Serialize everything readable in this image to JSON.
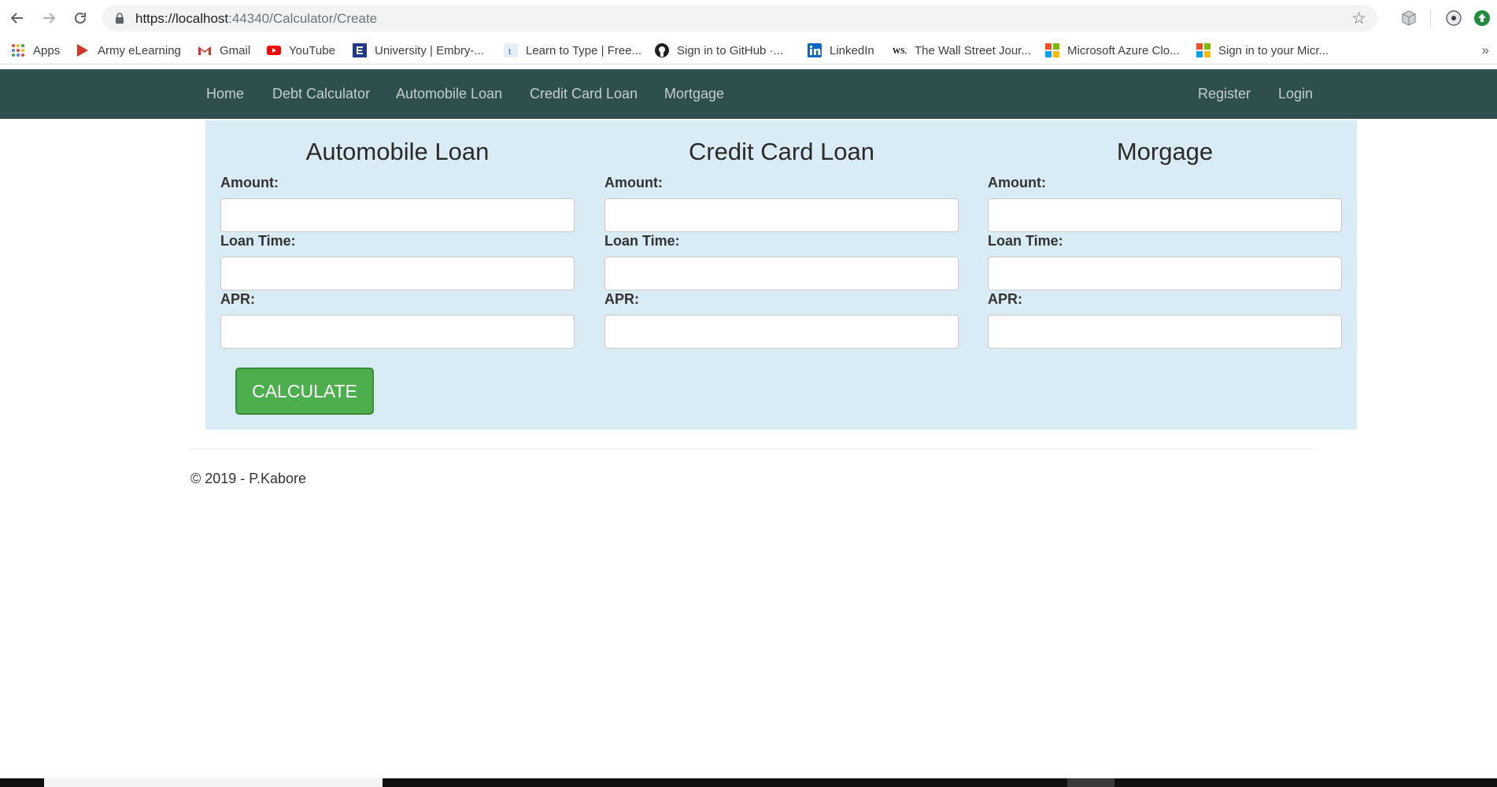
{
  "browser": {
    "url_prefix": "https://localhost",
    "url_suffix": ":44340/Calculator/Create",
    "icons": {
      "back": "arrow-left-icon",
      "forward": "arrow-right-icon",
      "reload": "reload-icon",
      "secure": "lock-icon",
      "bookmark": "star-icon"
    }
  },
  "bookmarks": [
    {
      "label": "Apps",
      "icon": "apps-grid-icon"
    },
    {
      "label": "Army eLearning",
      "icon": "army-icon"
    },
    {
      "label": "Gmail",
      "icon": "gmail-icon"
    },
    {
      "label": "YouTube",
      "icon": "youtube-icon"
    },
    {
      "label": "University | Embry-...",
      "icon": "university-icon"
    },
    {
      "label": "Learn to Type | Free...",
      "icon": "typing-icon"
    },
    {
      "label": "Sign in to GitHub ·...",
      "icon": "github-icon"
    },
    {
      "label": "LinkedIn",
      "icon": "linkedin-icon"
    },
    {
      "label": "The Wall Street Jour...",
      "icon": "wsj-icon"
    },
    {
      "label": "Microsoft Azure Clo...",
      "icon": "microsoft-icon"
    },
    {
      "label": "Sign in to your Micr...",
      "icon": "microsoft-icon"
    }
  ],
  "bookmarks_more": "»",
  "nav": {
    "home": "Home",
    "debt_calculator": "Debt Calculator",
    "automobile_loan": "Automobile Loan",
    "credit_card_loan": "Credit Card Loan",
    "mortgage": "Mortgage",
    "register": "Register",
    "login": "Login"
  },
  "calculator": {
    "columns": [
      {
        "title": "Automobile Loan",
        "amount_label": "Amount:",
        "amount_value": "",
        "time_label": "Loan Time:",
        "time_value": "",
        "apr_label": "APR:",
        "apr_value": ""
      },
      {
        "title": "Credit Card Loan",
        "amount_label": "Amount:",
        "amount_value": "",
        "time_label": "Loan Time:",
        "time_value": "",
        "apr_label": "APR:",
        "apr_value": ""
      },
      {
        "title": "Morgage",
        "amount_label": "Amount:",
        "amount_value": "",
        "time_label": "Loan Time:",
        "time_value": "",
        "apr_label": "APR:",
        "apr_value": ""
      }
    ],
    "button_label": "CALCULATE"
  },
  "footer": {
    "text": "© 2019 - P.Kabore"
  },
  "colors": {
    "navbar": "#2f4f4f",
    "panel": "#d9ecf5",
    "button": "#4cae4c"
  }
}
